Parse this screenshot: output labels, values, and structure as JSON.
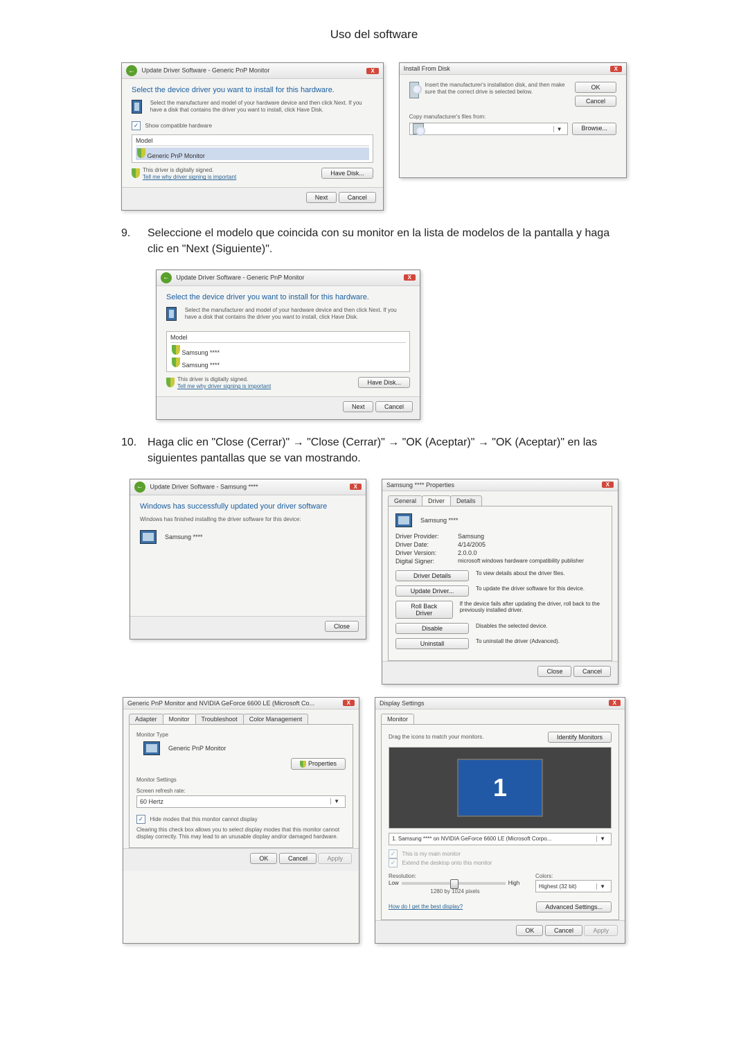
{
  "page_title": "Uso del software",
  "dlg1": {
    "header": "Update Driver Software - Generic PnP Monitor",
    "heading": "Select the device driver you want to install for this hardware.",
    "instr": "Select the manufacturer and model of your hardware device and then click Next. If you have a disk that contains the driver you want to install, click Have Disk.",
    "show_compat": "Show compatible hardware",
    "model_lbl": "Model",
    "model_item": "Generic PnP Monitor",
    "signed": "This driver is digitally signed.",
    "tell_me": "Tell me why driver signing is important",
    "have_disk": "Have Disk...",
    "next": "Next",
    "cancel": "Cancel"
  },
  "dlg2": {
    "title": "Install From Disk",
    "instr": "Insert the manufacturer's installation disk, and then make sure that the correct drive is selected below.",
    "ok": "OK",
    "cancel": "Cancel",
    "copy_lbl": "Copy manufacturer's files from:",
    "browse": "Browse..."
  },
  "step9": "Seleccione el modelo que coincida con su monitor en la lista de modelos de la pantalla y haga clic en \"Next (Siguiente)\".",
  "dlg3": {
    "header": "Update Driver Software - Generic PnP Monitor",
    "heading": "Select the device driver you want to install for this hardware.",
    "instr": "Select the manufacturer and model of your hardware device and then click Next. If you have a disk that contains the driver you want to install, click Have Disk.",
    "model_lbl": "Model",
    "m1": "Samsung ****",
    "m2": "Samsung ****",
    "signed": "This driver is digitally signed.",
    "tell_me": "Tell me why driver signing is important",
    "have_disk": "Have Disk...",
    "next": "Next",
    "cancel": "Cancel"
  },
  "step10": "Haga clic en \"Close (Cerrar)\" → \"Close (Cerrar)\" → \"OK (Aceptar)\" → \"OK (Aceptar)\" en las siguientes pantallas que se van mostrando.",
  "dlg4": {
    "header": "Update Driver Software - Samsung ****",
    "heading": "Windows has successfully updated your driver software",
    "sub": "Windows has finished installing the driver software for this device:",
    "dev": "Samsung ****",
    "close": "Close"
  },
  "dlg5": {
    "title": "Samsung **** Properties",
    "t_general": "General",
    "t_driver": "Driver",
    "t_details": "Details",
    "dev": "Samsung ****",
    "p1l": "Driver Provider:",
    "p1v": "Samsung",
    "p2l": "Driver Date:",
    "p2v": "4/14/2005",
    "p3l": "Driver Version:",
    "p3v": "2.0.0.0",
    "p4l": "Digital Signer:",
    "p4v": "microsoft windows hardware compatibility publisher",
    "b1": "Driver Details",
    "d1": "To view details about the driver files.",
    "b2": "Update Driver...",
    "d2": "To update the driver software for this device.",
    "b3": "Roll Back Driver",
    "d3": "If the device fails after updating the driver, roll back to the previously installed driver.",
    "b4": "Disable",
    "d4": "Disables the selected device.",
    "b5": "Uninstall",
    "d5": "To uninstall the driver (Advanced).",
    "close": "Close",
    "cancel": "Cancel"
  },
  "dlg6": {
    "title": "Generic PnP Monitor and NVIDIA GeForce 6600 LE (Microsoft Co...",
    "t_adapter": "Adapter",
    "t_monitor": "Monitor",
    "t_trouble": "Troubleshoot",
    "t_color": "Color Management",
    "mt": "Monitor Type",
    "mt_val": "Generic PnP Monitor",
    "props": "Properties",
    "ms": "Monitor Settings",
    "refresh_lbl": "Screen refresh rate:",
    "refresh_val": "60 Hertz",
    "hide": "Hide modes that this monitor cannot display",
    "hide_desc": "Clearing this check box allows you to select display modes that this monitor cannot display correctly. This may lead to an unusable display and/or damaged hardware.",
    "ok": "OK",
    "cancel": "Cancel",
    "apply": "Apply"
  },
  "dlg7": {
    "title": "Display Settings",
    "t_monitor": "Monitor",
    "drag": "Drag the icons to match your monitors.",
    "identify": "Identify Monitors",
    "sel": "1. Samsung **** on NVIDIA GeForce 6600 LE (Microsoft Corpo...",
    "main": "This is my main monitor",
    "extend": "Extend the desktop onto this monitor",
    "res_lbl": "Resolution:",
    "low": "Low",
    "high": "High",
    "res_val": "1280 by 1024 pixels",
    "colors_lbl": "Colors:",
    "colors_val": "Highest (32 bit)",
    "best": "How do I get the best display?",
    "adv": "Advanced Settings...",
    "ok": "OK",
    "cancel": "Cancel",
    "apply": "Apply"
  }
}
